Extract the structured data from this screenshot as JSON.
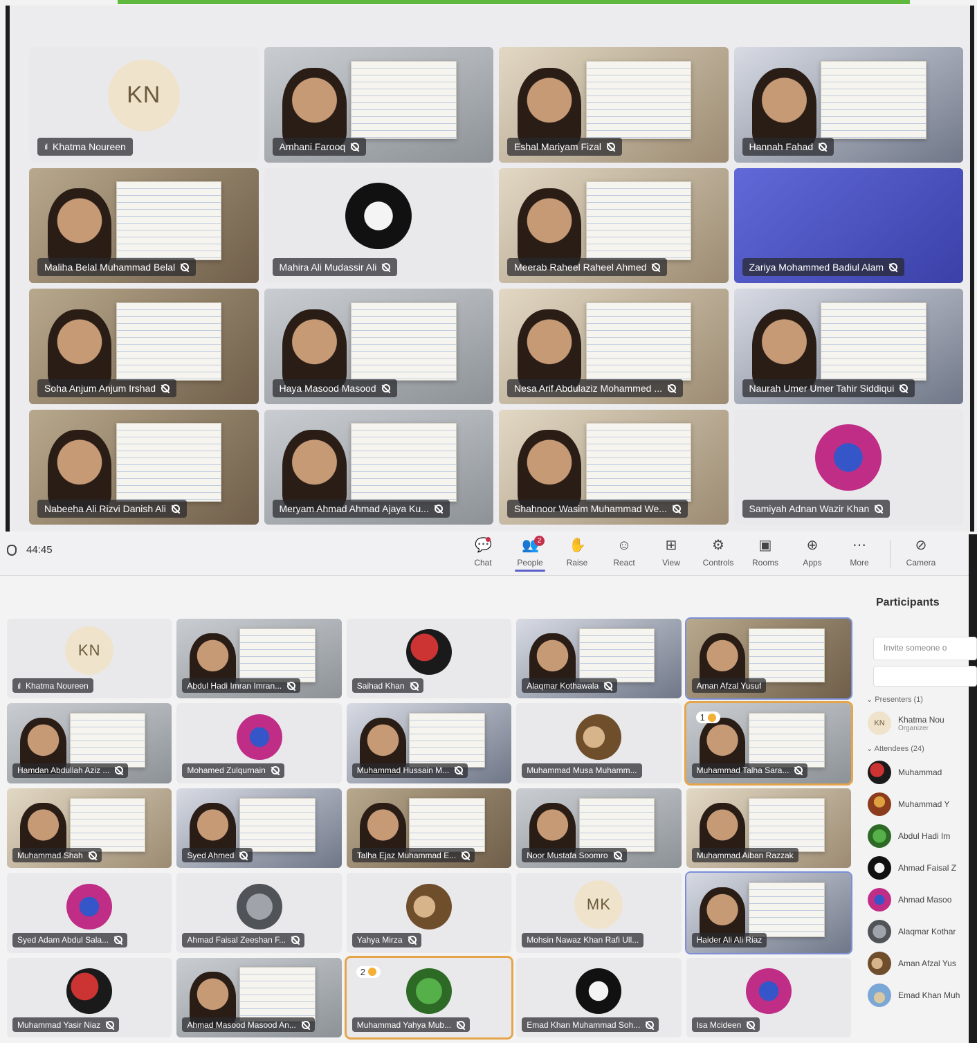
{
  "top_panel": {
    "tiles": [
      {
        "name": "Khatma Noureen",
        "initials": "KN",
        "kind": "initials",
        "signal": "ıl"
      },
      {
        "name": "Amhani Farooq",
        "kind": "video",
        "muted": true
      },
      {
        "name": "Eshal Mariyam Fizal",
        "kind": "video",
        "muted": true
      },
      {
        "name": "Hannah Fahad",
        "kind": "video",
        "muted": true
      },
      {
        "name": "Maliha Belal Muhammad Belal",
        "kind": "video",
        "muted": true
      },
      {
        "name": "Mahira Ali Mudassir Ali",
        "kind": "avatar",
        "muted": true
      },
      {
        "name": "Meerab Raheel Raheel Ahmed",
        "kind": "video",
        "muted": true
      },
      {
        "name": "Zariya Mohammed Badiul Alam",
        "kind": "video",
        "muted": true
      },
      {
        "name": "Soha Anjum Anjum Irshad",
        "kind": "video",
        "muted": true
      },
      {
        "name": "Haya Masood Masood",
        "kind": "video",
        "muted": true
      },
      {
        "name": "Nesa Arif Abdulaziz Mohammed ...",
        "kind": "video",
        "muted": true
      },
      {
        "name": "Naurah Umer Umer Tahir Siddiqui",
        "kind": "video",
        "muted": true
      },
      {
        "name": "Nabeeha Ali Rizvi Danish Ali",
        "kind": "video",
        "muted": true
      },
      {
        "name": "Meryam Ahmad Ahmad Ajaya Ku...",
        "kind": "video",
        "muted": true
      },
      {
        "name": "Shahnoor Wasim Muhammad We...",
        "kind": "video",
        "muted": true
      },
      {
        "name": "Samiyah Adnan Wazir Khan",
        "kind": "avatar",
        "muted": true
      }
    ]
  },
  "toolbar": {
    "timer": "44:45",
    "items": [
      {
        "label": "Chat",
        "icon": "chat-icon",
        "glyph": "💬"
      },
      {
        "label": "People",
        "icon": "people-icon",
        "glyph": "👥",
        "badge": "2"
      },
      {
        "label": "Raise",
        "icon": "raise-hand-icon",
        "glyph": "✋"
      },
      {
        "label": "React",
        "icon": "react-icon",
        "glyph": "☺"
      },
      {
        "label": "View",
        "icon": "view-icon",
        "glyph": "⊞"
      },
      {
        "label": "Controls",
        "icon": "controls-icon",
        "glyph": "⚙"
      },
      {
        "label": "Rooms",
        "icon": "rooms-icon",
        "glyph": "▣"
      },
      {
        "label": "Apps",
        "icon": "apps-icon",
        "glyph": "⊕"
      },
      {
        "label": "More",
        "icon": "more-icon",
        "glyph": "⋯"
      }
    ],
    "camera_label": "Camera"
  },
  "bottom_panel": {
    "tiles": [
      {
        "name": "Khatma Noureen",
        "initials": "KN",
        "kind": "initials",
        "signal": "ıl"
      },
      {
        "name": "Abdul Hadi Imran Imran...",
        "kind": "video",
        "muted": true
      },
      {
        "name": "Saihad Khan",
        "kind": "avatar",
        "muted": true
      },
      {
        "name": "Alaqmar Kothawala",
        "kind": "video",
        "muted": true
      },
      {
        "name": "Aman Afzal Yusuf",
        "kind": "video",
        "active": true
      },
      {
        "name": "Hamdan Abdullah Aziz ...",
        "kind": "video",
        "muted": true
      },
      {
        "name": "Mohamed Zulqurnain",
        "kind": "avatar",
        "muted": true
      },
      {
        "name": "Muhammad Hussain M...",
        "kind": "video",
        "muted": true
      },
      {
        "name": "Muhammad Musa Muhamm...",
        "kind": "avatar"
      },
      {
        "name": "Muhammad Talha Sara...",
        "kind": "video",
        "muted": true,
        "hand": "1",
        "selected": true
      },
      {
        "name": "Muhammad Shah",
        "kind": "video",
        "muted": true
      },
      {
        "name": "Syed Ahmed",
        "kind": "video",
        "muted": true
      },
      {
        "name": "Talha Ejaz Muhammad E...",
        "kind": "video",
        "muted": true
      },
      {
        "name": "Noor Mustafa Soomro",
        "kind": "video",
        "muted": true
      },
      {
        "name": "Muhammad Aiban Razzak",
        "kind": "video"
      },
      {
        "name": "Syed Adam Abdul Sala...",
        "kind": "avatar",
        "muted": true
      },
      {
        "name": "Ahmad Faisal Zeeshan F...",
        "kind": "avatar",
        "muted": true
      },
      {
        "name": "Yahya Mirza",
        "kind": "avatar",
        "muted": true
      },
      {
        "name": "Mohsin Nawaz Khan Rafi Ull...",
        "initials": "MK",
        "kind": "initials"
      },
      {
        "name": "Haider Ali Ali Riaz",
        "kind": "video",
        "active": true
      },
      {
        "name": "Muhammad Yasir Niaz",
        "kind": "avatar",
        "muted": true
      },
      {
        "name": "Ahmad Masood Masood An...",
        "kind": "video",
        "muted": true
      },
      {
        "name": "Muhammad Yahya Mub...",
        "kind": "avatar",
        "muted": true,
        "hand": "2",
        "selected": true
      },
      {
        "name": "Emad Khan Muhammad Soh...",
        "kind": "avatar",
        "muted": true
      },
      {
        "name": "Isa Mcideen",
        "kind": "avatar",
        "muted": true
      }
    ]
  },
  "participants": {
    "title": "Participants",
    "invite_placeholder": "Invite someone o",
    "presenters_label": "Presenters (1)",
    "attendees_label": "Attendees (24)",
    "presenter": {
      "name": "Khatma Nou",
      "initials": "KN",
      "role": "Organizer"
    },
    "attendees": [
      "Muhammad",
      "Muhammad Y",
      "Abdul Hadi Im",
      "Ahmad Faisal Z",
      "Ahmad Masoo",
      "Alaqmar Kothar",
      "Aman Afzal Yus",
      "Emad Khan Muh"
    ]
  }
}
